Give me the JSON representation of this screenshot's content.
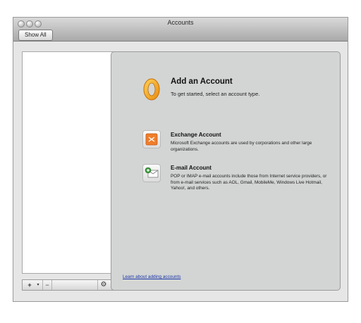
{
  "window": {
    "title": "Accounts",
    "show_all_label": "Show All"
  },
  "right_pane": {
    "heading": "Add an Account",
    "subheading": "To get started, select an account type.",
    "accounts": [
      {
        "title": "Exchange Account",
        "description": "Microsoft Exchange accounts are used by corporations and other large organizations.",
        "icon": "exchange-icon"
      },
      {
        "title": "E-mail Account",
        "description": "POP or IMAP e-mail accounts include those from Internet service providers, or from e-mail services such as AOL, Gmail, MobileMe, Windows Live Hotmail, Yahoo!, and others.",
        "icon": "email-account-icon"
      }
    ],
    "learn_link": "Learn about adding accounts"
  },
  "bottom_bar": {
    "add_symbol": "+",
    "dropdown_symbol": "▾",
    "remove_symbol": "−",
    "gear_symbol": "⚙"
  },
  "colors": {
    "link": "#1a35a6",
    "outlook_orange": "#f2a21b",
    "exchange_orange": "#ef7d2a"
  }
}
